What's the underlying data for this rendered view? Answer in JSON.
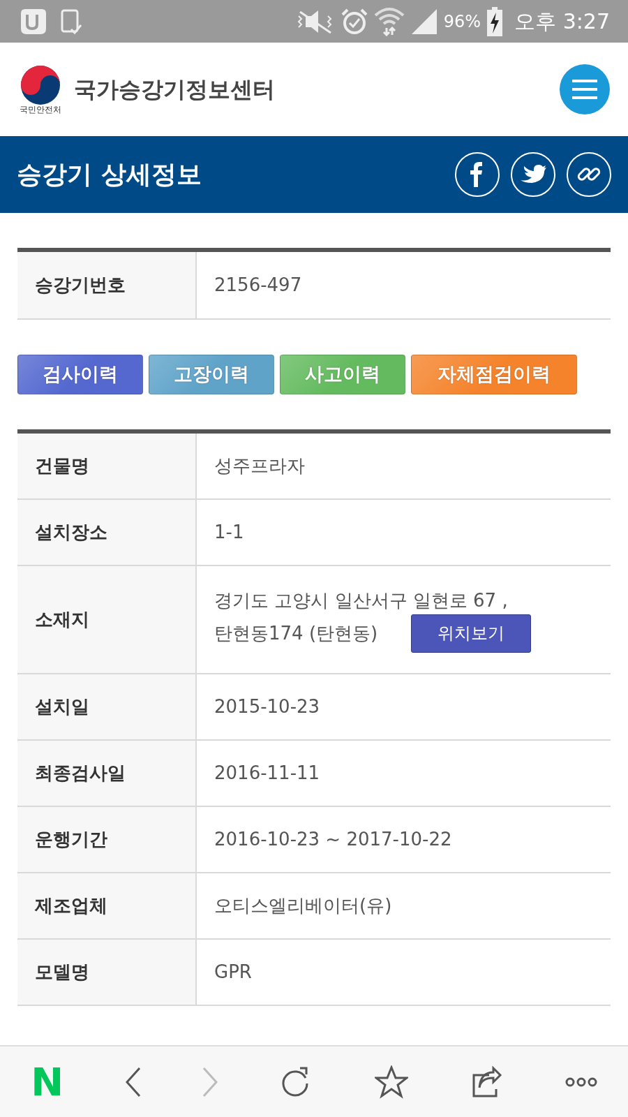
{
  "status_bar": {
    "battery": "96%",
    "time": "오후 3:27"
  },
  "header": {
    "logo_caption": "국민안전처",
    "site_title": "국가승강기정보센터"
  },
  "title_band": {
    "title": "승강기 상세정보"
  },
  "number_table": {
    "label": "승강기번호",
    "value": "2156-497"
  },
  "history_buttons": [
    {
      "label": "검사이력",
      "color": "#5468d0"
    },
    {
      "label": "고장이력",
      "color": "#5fa3c9"
    },
    {
      "label": "사고이력",
      "color": "#64bb5f"
    },
    {
      "label": "자체점검이력",
      "color": "#f5832b"
    }
  ],
  "details": [
    {
      "kind": "text",
      "label": "건물명",
      "value": "성주프라자"
    },
    {
      "kind": "text",
      "label": "설치장소",
      "value": "1-1"
    },
    {
      "kind": "address",
      "label": "소재지",
      "lines": [
        "경기도 고양시 일산서구 일현로 67 ,",
        "탄현동174 (탄현동)"
      ],
      "button": "위치보기"
    },
    {
      "kind": "text",
      "label": "설치일",
      "value": "2015-10-23"
    },
    {
      "kind": "text",
      "label": "최종검사일",
      "value": "2016-11-11"
    },
    {
      "kind": "text",
      "label": "운행기간",
      "value": "2016-10-23 ~ 2017-10-22"
    },
    {
      "kind": "text",
      "label": "제조업체",
      "value": "오티스엘리베이터(유)"
    },
    {
      "kind": "text",
      "label": "모델명",
      "value": "GPR"
    }
  ],
  "toolbar": [
    {
      "kind": "home",
      "text": "N",
      "disabled": false
    },
    {
      "kind": "back",
      "disabled": false
    },
    {
      "kind": "forward",
      "disabled": true
    },
    {
      "kind": "reload",
      "disabled": false
    },
    {
      "kind": "bookmark",
      "disabled": false
    },
    {
      "kind": "share",
      "disabled": false
    },
    {
      "kind": "more",
      "disabled": false
    }
  ]
}
